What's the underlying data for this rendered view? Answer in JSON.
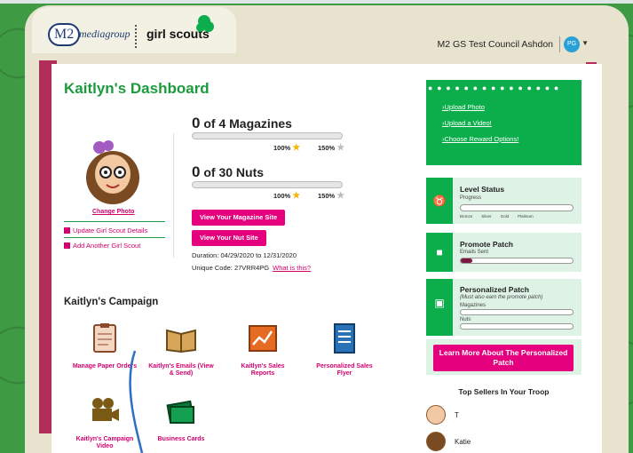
{
  "header": {
    "brand_m2": "M2",
    "brand_media": "mediagroup",
    "brand_gs": "girl scouts",
    "council": "M2 GS Test Council Ashdon",
    "user_initials": "PG"
  },
  "dashboard": {
    "title": "Kaitlyn's Dashboard",
    "change_photo": "Change Photo",
    "update_link": "Update Girl Scout Details",
    "add_link": "Add Another Girl Scout"
  },
  "goals": [
    {
      "count": "0",
      "label": "of 4 Magazines",
      "pct100": "100%",
      "pct150": "150%",
      "progress": 0
    },
    {
      "count": "0",
      "label": "of 30 Nuts",
      "pct100": "100%",
      "pct150": "150%",
      "progress": 0
    }
  ],
  "buttons": {
    "magazine_site": "View Your Magazine Site",
    "nut_site": "View Your Nut Site"
  },
  "duration": "Duration: 04/29/2020 to 12/31/2020",
  "unique_code": "Unique Code: 27VRR4PG",
  "what_is_this": "What is this?",
  "campaign": {
    "title": "Kaitlyn's Campaign",
    "tiles": [
      "Manage Paper Orders",
      "Kaitlyn's Emails (View & Send)",
      "Kaitlyn's Sales Reports",
      "Personalized Sales Flyer",
      "Kaitlyn's Campaign Video",
      "Business Cards"
    ]
  },
  "right": {
    "links": [
      "Upload Photo",
      "Upload a Video!",
      "Choose Reward Options!"
    ],
    "level": {
      "title": "Level Status",
      "sub": "Progress",
      "levels": [
        "Bronze",
        "Silver",
        "Gold",
        "Platinum"
      ]
    },
    "promote": {
      "title": "Promote Patch",
      "sub": "Emails Sent",
      "progress": 0.1
    },
    "personalized": {
      "title": "Personalized Patch",
      "note": "(Must also earn the promote patch)",
      "mag": "Magazines",
      "nuts": "Nuts"
    },
    "learn": "Learn More About The Personalized Patch",
    "top_sellers": "Top Sellers In Your Troop",
    "sellers": [
      "T",
      "Katie"
    ]
  },
  "colors": {
    "green": "#1c9a3e",
    "pink": "#e5007d",
    "bg": "#3f9a44"
  }
}
